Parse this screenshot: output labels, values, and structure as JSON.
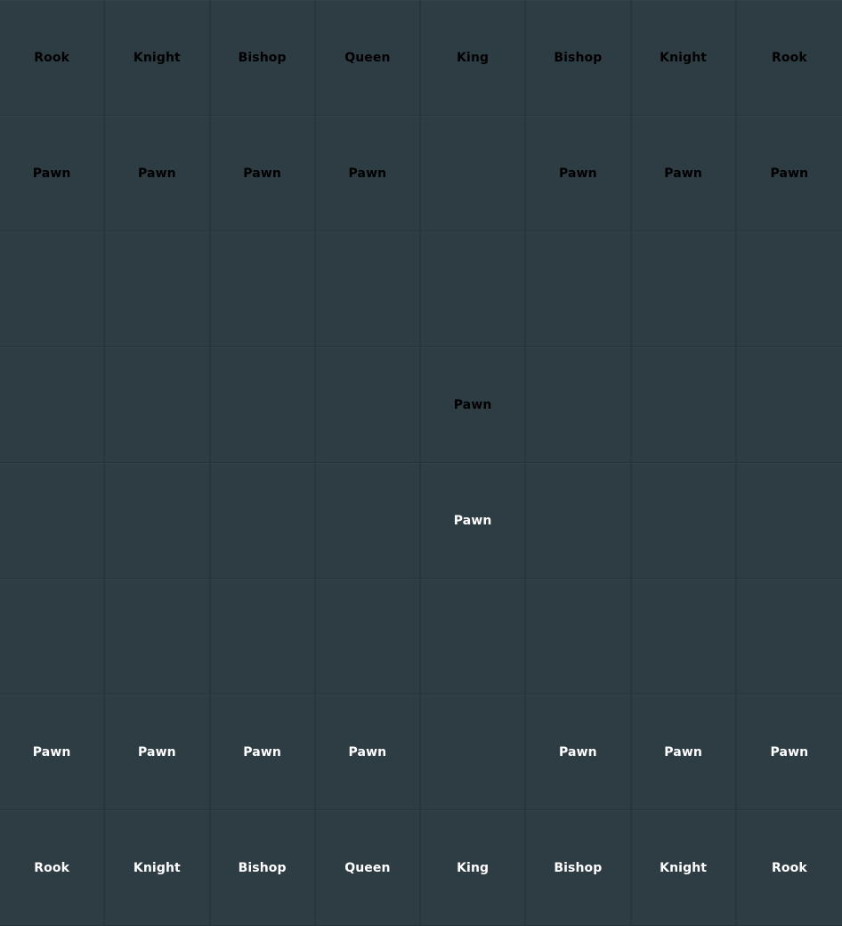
{
  "board": {
    "square_color": "#2e3c44",
    "piece_colors": {
      "black": "#000000",
      "white": "#ffffff"
    },
    "rows": [
      [
        {
          "label": "Rook",
          "side": "black"
        },
        {
          "label": "Knight",
          "side": "black"
        },
        {
          "label": "Bishop",
          "side": "black"
        },
        {
          "label": "Queen",
          "side": "black"
        },
        {
          "label": "King",
          "side": "black"
        },
        {
          "label": "Bishop",
          "side": "black"
        },
        {
          "label": "Knight",
          "side": "black"
        },
        {
          "label": "Rook",
          "side": "black"
        }
      ],
      [
        {
          "label": "Pawn",
          "side": "black"
        },
        {
          "label": "Pawn",
          "side": "black"
        },
        {
          "label": "Pawn",
          "side": "black"
        },
        {
          "label": "Pawn",
          "side": "black"
        },
        null,
        {
          "label": "Pawn",
          "side": "black"
        },
        {
          "label": "Pawn",
          "side": "black"
        },
        {
          "label": "Pawn",
          "side": "black"
        }
      ],
      [
        null,
        null,
        null,
        null,
        null,
        null,
        null,
        null
      ],
      [
        null,
        null,
        null,
        null,
        {
          "label": "Pawn",
          "side": "black"
        },
        null,
        null,
        null
      ],
      [
        null,
        null,
        null,
        null,
        {
          "label": "Pawn",
          "side": "white"
        },
        null,
        null,
        null
      ],
      [
        null,
        null,
        null,
        null,
        null,
        null,
        null,
        null
      ],
      [
        {
          "label": "Pawn",
          "side": "white"
        },
        {
          "label": "Pawn",
          "side": "white"
        },
        {
          "label": "Pawn",
          "side": "white"
        },
        {
          "label": "Pawn",
          "side": "white"
        },
        null,
        {
          "label": "Pawn",
          "side": "white"
        },
        {
          "label": "Pawn",
          "side": "white"
        },
        {
          "label": "Pawn",
          "side": "white"
        }
      ],
      [
        {
          "label": "Rook",
          "side": "white"
        },
        {
          "label": "Knight",
          "side": "white"
        },
        {
          "label": "Bishop",
          "side": "white"
        },
        {
          "label": "Queen",
          "side": "white"
        },
        {
          "label": "King",
          "side": "white"
        },
        {
          "label": "Bishop",
          "side": "white"
        },
        {
          "label": "Knight",
          "side": "white"
        },
        {
          "label": "Rook",
          "side": "white"
        }
      ]
    ]
  }
}
